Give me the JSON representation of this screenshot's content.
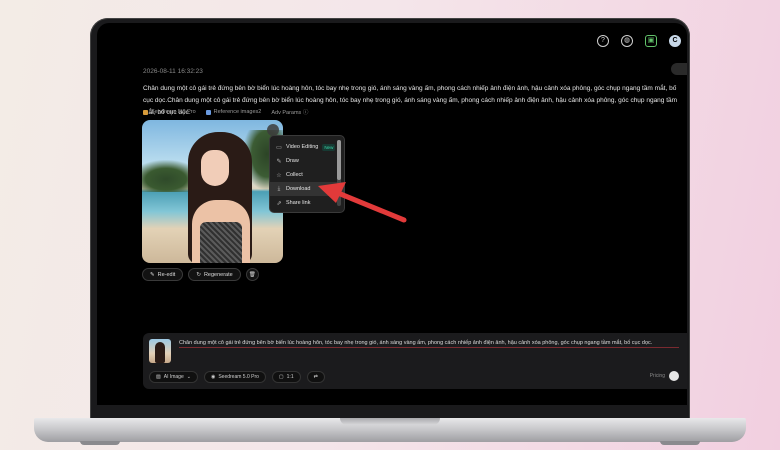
{
  "generation": {
    "timestamp": "2026-08-11 16:32:23",
    "prompt": "Chân dung một cô gái trẻ đứng bên bờ biển lúc hoàng hôn, tóc bay nhẹ trong gió, ánh sáng vàng ấm, phong cách nhiếp ảnh điện ảnh, hậu cảnh xóa phông, góc chụp ngang tầm mắt, bố cục dọc.Chân dung một cô gái trẻ đứng bên bờ biển lúc hoàng hôn, tóc bay nhẹ trong gió, ánh sáng vàng ấm, phong cách nhiếp ảnh điện ảnh, hậu cảnh xóa phông, góc chụp ngang tầm mắt, bố cục dọc.",
    "model_chip": "Seedream 5.0 Pro",
    "reference_chip": "Reference images2",
    "params_chip": "Adv Params ⓘ"
  },
  "image_actions": {
    "reedit_label": "Re-edit",
    "regenerate_label": "Regenerate"
  },
  "context_menu": {
    "video_editing": "Video Editing",
    "new_badge": "New",
    "draw": "Draw",
    "collect": "Collect",
    "download": "Download",
    "share_link": "Share link"
  },
  "composer": {
    "text": "Chân dung một cô gái trẻ đứng bên bờ biển lúc hoàng hôn, tóc bay nhẹ trong gió, ánh sáng vàng ấm, phong cách nhiếp ảnh điện ảnh, hậu cảnh xóa phông, góc chụp ngang tầm mắt, bố cục dọc.",
    "mode_chip": "AI Image",
    "model_chip": "Seedream 5.0 Pro",
    "ratio_chip": "1:1",
    "pricing_label": "Pricing"
  },
  "colors": {
    "accent_arrow": "#e23a3a",
    "new_badge": "#3ad5a8",
    "background": "#000000"
  },
  "icons": [
    "help-icon",
    "globe-icon",
    "gift-icon",
    "avatar-icon",
    "video-icon",
    "pen-icon",
    "star-icon",
    "download-icon",
    "share-icon",
    "trash-icon",
    "swap-icon"
  ]
}
